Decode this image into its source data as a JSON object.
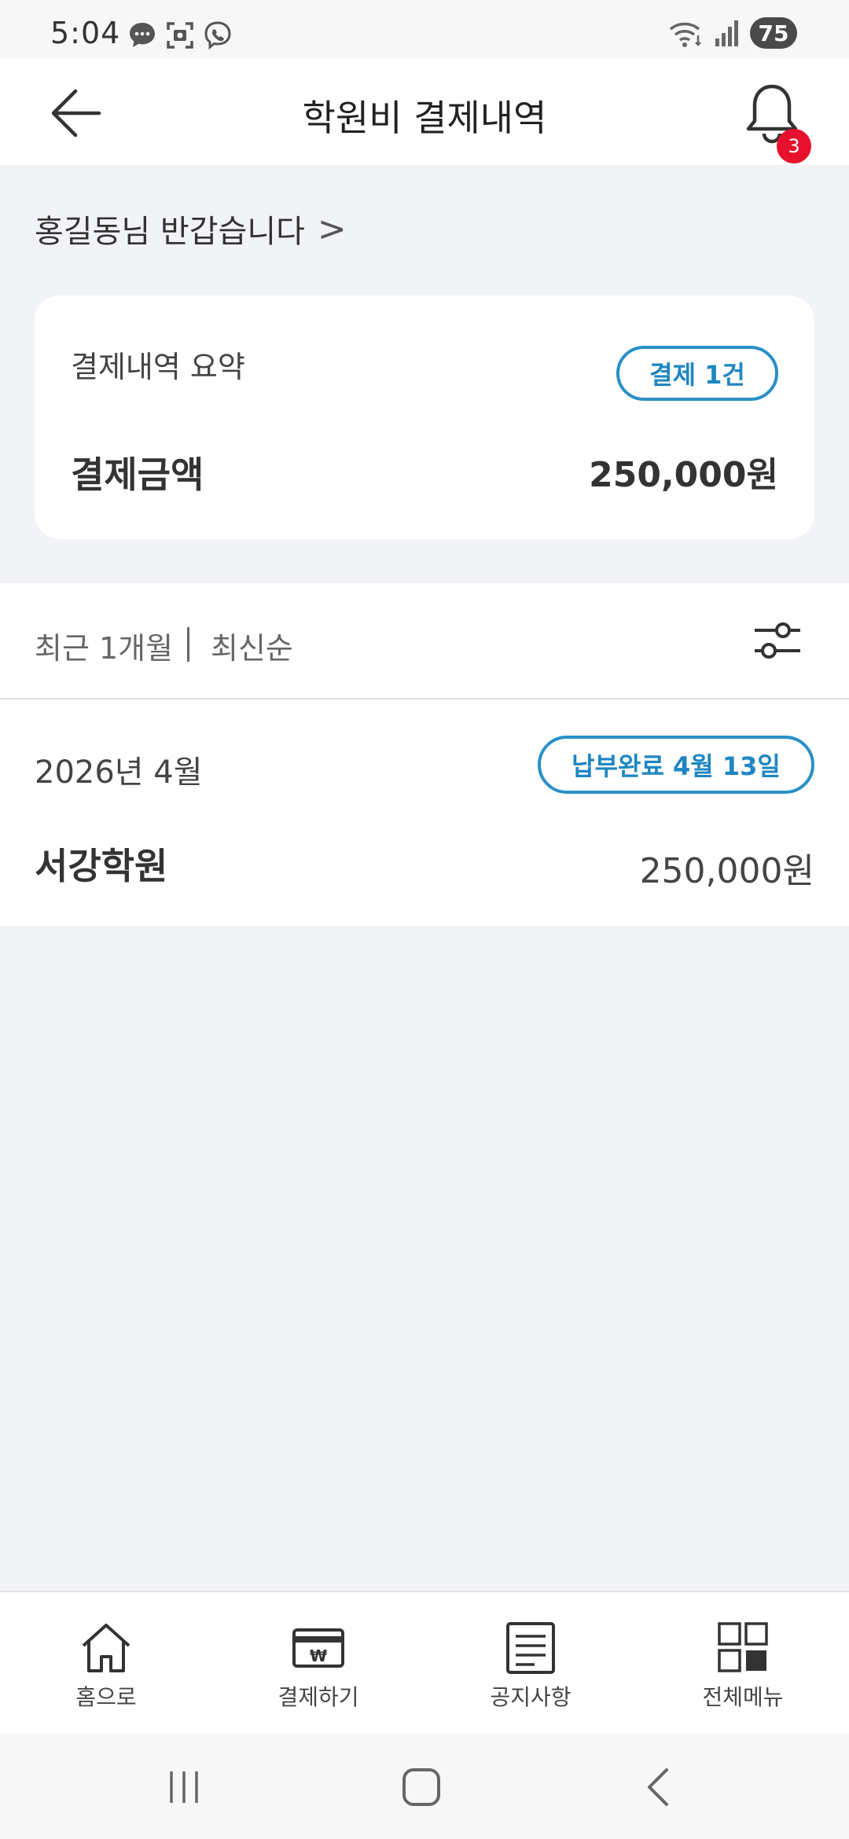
{
  "status_bar": {
    "time": "5:04",
    "battery": "75",
    "left_icons": [
      "message-icon",
      "screenshot-icon",
      "viber-icon"
    ],
    "right_icons": [
      "wifi-icon",
      "signal-icon",
      "battery-icon"
    ]
  },
  "header": {
    "title": "학원비 결제내역",
    "notification_count": "3"
  },
  "greeting": {
    "text": "홍길동님 반갑습니다",
    "chevron": ">"
  },
  "summary": {
    "label": "결제내역 요약",
    "count_chip": "결제 1건",
    "amount_label": "결제금액",
    "amount_value": "250,000원"
  },
  "filter": {
    "period": "최근 1개월",
    "sort": "최신순"
  },
  "payments": [
    {
      "month": "2026년 4월",
      "status": "납부완료 4월 13일",
      "academy": "서강학원",
      "amount": "250,000원"
    }
  ],
  "bottom_nav": [
    {
      "label": "홈으로",
      "icon": "home-icon"
    },
    {
      "label": "결제하기",
      "icon": "card-won-icon"
    },
    {
      "label": "공지사항",
      "icon": "notice-icon"
    },
    {
      "label": "전체메뉴",
      "icon": "grid-menu-icon"
    }
  ],
  "colors": {
    "accent": "#1f86c2",
    "badge": "#e8112d",
    "background": "#f1f3f7"
  }
}
